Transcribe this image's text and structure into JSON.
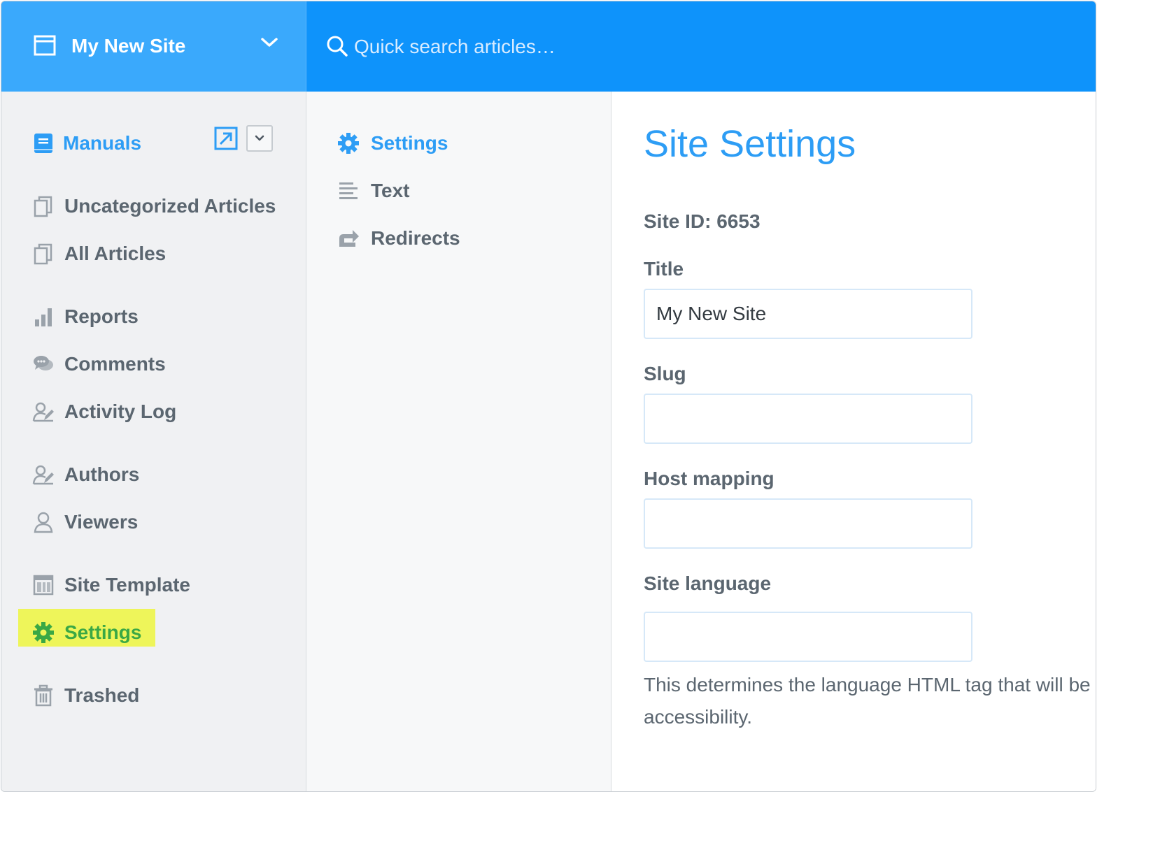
{
  "header": {
    "site_name": "My New Site",
    "search_placeholder": "Quick search articles…",
    "bar_color": "#0e93fb",
    "switcher_color": "#3aa9fc"
  },
  "sidebar": {
    "manuals_label": "Manuals",
    "items": [
      {
        "label": "Uncategorized Articles",
        "icon": "copy-icon"
      },
      {
        "label": "All Articles",
        "icon": "copy-icon"
      },
      {
        "label": "Reports",
        "icon": "bar-chart-icon"
      },
      {
        "label": "Comments",
        "icon": "comments-icon"
      },
      {
        "label": "Activity Log",
        "icon": "user-edit-icon"
      },
      {
        "label": "Authors",
        "icon": "user-edit-icon"
      },
      {
        "label": "Viewers",
        "icon": "user-icon"
      },
      {
        "label": "Site Template",
        "icon": "template-icon"
      },
      {
        "label": "Settings",
        "icon": "gear-icon",
        "highlighted": true
      },
      {
        "label": "Trashed",
        "icon": "trash-icon"
      }
    ]
  },
  "settings_nav": {
    "items": [
      {
        "label": "Settings",
        "icon": "gear-icon",
        "active": true
      },
      {
        "label": "Text",
        "icon": "text-lines-icon"
      },
      {
        "label": "Redirects",
        "icon": "redirect-icon"
      }
    ]
  },
  "content": {
    "title": "Site Settings",
    "site_id": "Site ID: 6653",
    "fields": {
      "title_label": "Title",
      "title_value": "My New Site",
      "slug_label": "Slug",
      "slug_value": "",
      "host_label": "Host mapping",
      "host_value": "",
      "language_label": "Site language",
      "language_value": ""
    },
    "help_line1": "This determines the language HTML tag that will be",
    "help_line2": "accessibility."
  },
  "colors": {
    "accent": "#2d9df5",
    "highlight": "#eef55a",
    "highlight_text": "#3aa845"
  }
}
